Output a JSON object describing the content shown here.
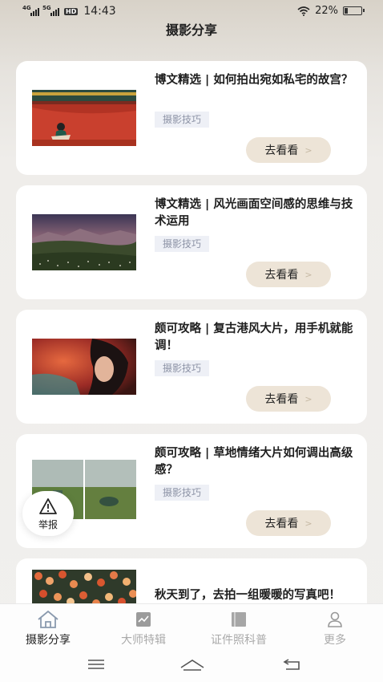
{
  "status": {
    "sig1": "4G",
    "sig2": "5G",
    "hd": "HD",
    "time": "14:43",
    "battery": "22%",
    "battery_level": 0.22
  },
  "header": {
    "title": "摄影分享"
  },
  "cards": [
    {
      "title": "博文精选 | 如何拍出宛如私宅的故宫？",
      "tag": "摄影技巧",
      "button": "去看看"
    },
    {
      "title": "博文精选 | 风光画面空间感的思维与技术运用",
      "tag": "摄影技巧",
      "button": "去看看"
    },
    {
      "title": "颇可攻略 | 复古港风大片，用手机就能调！",
      "tag": "摄影技巧",
      "button": "去看看"
    },
    {
      "title": "颇可攻略 | 草地情绪大片如何调出高级感？",
      "tag": "摄影技巧",
      "button": "去看看"
    },
    {
      "title": "秋天到了，去拍一组暖暖的写真吧！"
    }
  ],
  "report": {
    "label": "举报"
  },
  "tabs": [
    {
      "label": "摄影分享",
      "icon": "home-icon",
      "active": true
    },
    {
      "label": "大师特辑",
      "icon": "chart-icon",
      "active": false
    },
    {
      "label": "证件照科普",
      "icon": "book-icon",
      "active": false
    },
    {
      "label": "更多",
      "icon": "user-icon",
      "active": false
    }
  ],
  "nav": [
    "menu-icon",
    "home-nav-icon",
    "back-icon"
  ]
}
